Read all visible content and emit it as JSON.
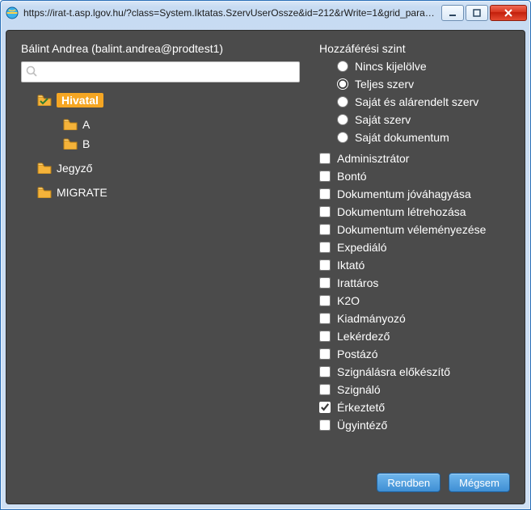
{
  "window": {
    "url": "https://irat-t.asp.lgov.hu/?class=System.Iktatas.SzervUserOssze&id=212&rWrite=1&grid_param..."
  },
  "user": {
    "display": "Bálint Andrea (balint.andrea@prodtest1)"
  },
  "search": {
    "placeholder": "",
    "value": ""
  },
  "tree": [
    {
      "label": "Hivatal",
      "level": 0,
      "selected": true,
      "icon": "folder-check"
    },
    {
      "label": "A",
      "level": 1,
      "selected": false,
      "icon": "folder"
    },
    {
      "label": "B",
      "level": 1,
      "selected": false,
      "icon": "folder"
    },
    {
      "label": "Jegyző",
      "level": 0,
      "selected": false,
      "icon": "folder"
    },
    {
      "label": "MIGRATE",
      "level": 0,
      "selected": false,
      "icon": "folder"
    }
  ],
  "access": {
    "group_title": "Hozzáférési szint",
    "radios": [
      {
        "label": "Nincs kijelölve",
        "checked": false
      },
      {
        "label": "Teljes szerv",
        "checked": true
      },
      {
        "label": "Saját és alárendelt szerv",
        "checked": false
      },
      {
        "label": "Saját szerv",
        "checked": false
      },
      {
        "label": "Saját dokumentum",
        "checked": false
      }
    ],
    "checks": [
      {
        "label": "Adminisztrátor",
        "checked": false
      },
      {
        "label": "Bontó",
        "checked": false
      },
      {
        "label": "Dokumentum jóváhagyása",
        "checked": false
      },
      {
        "label": "Dokumentum létrehozása",
        "checked": false
      },
      {
        "label": "Dokumentum véleményezése",
        "checked": false
      },
      {
        "label": "Expediáló",
        "checked": false
      },
      {
        "label": "Iktató",
        "checked": false
      },
      {
        "label": "Irattáros",
        "checked": false
      },
      {
        "label": "K2O",
        "checked": false
      },
      {
        "label": "Kiadmányozó",
        "checked": false
      },
      {
        "label": "Lekérdező",
        "checked": false
      },
      {
        "label": "Postázó",
        "checked": false
      },
      {
        "label": "Szignálásra előkészítő",
        "checked": false
      },
      {
        "label": "Szignáló",
        "checked": false
      },
      {
        "label": "Érkeztető",
        "checked": true
      },
      {
        "label": "Ügyintéző",
        "checked": false
      }
    ]
  },
  "buttons": {
    "ok": "Rendben",
    "cancel": "Mégsem"
  }
}
